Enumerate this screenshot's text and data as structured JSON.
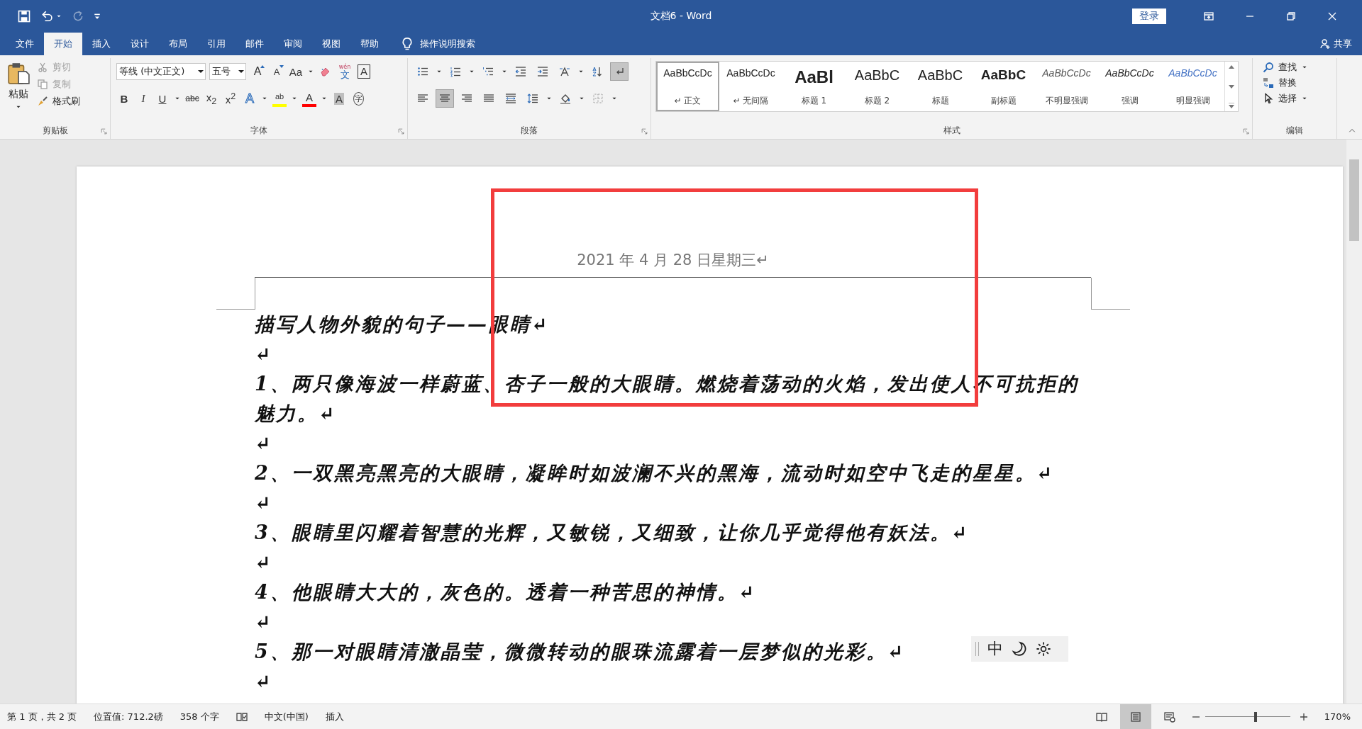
{
  "quick_access": [
    {
      "kind": "save",
      "disabled": false
    },
    {
      "kind": "undo",
      "disabled": false,
      "dropdown": true
    },
    {
      "kind": "redo",
      "disabled": true,
      "dropdown": false
    },
    {
      "kind": "customize",
      "disabled": false
    }
  ],
  "window": {
    "title": "文档6  -  Word",
    "sign_in": "登录"
  },
  "tabs": [
    {
      "label": "文件",
      "selected": false
    },
    {
      "label": "开始",
      "selected": true
    },
    {
      "label": "插入",
      "selected": false
    },
    {
      "label": "设计",
      "selected": false
    },
    {
      "label": "布局",
      "selected": false
    },
    {
      "label": "引用",
      "selected": false
    },
    {
      "label": "邮件",
      "selected": false
    },
    {
      "label": "审阅",
      "selected": false
    },
    {
      "label": "视图",
      "selected": false
    },
    {
      "label": "帮助",
      "selected": false
    }
  ],
  "tell_me": "操作说明搜索",
  "share": "共享",
  "clipboard": {
    "title": "剪贴板",
    "paste": "粘贴",
    "items": [
      {
        "kind": "cut",
        "label": "剪切",
        "disabled": true
      },
      {
        "kind": "copy",
        "label": "复制",
        "disabled": true
      },
      {
        "kind": "painter",
        "label": "格式刷",
        "disabled": false
      }
    ]
  },
  "font": {
    "title": "字体",
    "font_name": "等线 (中文正文)",
    "font_size": "五号",
    "row1": [
      {
        "kind": "grow",
        "label": "A",
        "dropdown": false
      },
      {
        "kind": "shrink",
        "label": "A",
        "dropdown": false
      },
      {
        "kind": "case",
        "label": "Aa",
        "dropdown": true
      },
      {
        "kind": "clear",
        "dropdown": false
      },
      {
        "kind": "phonetic",
        "label": "文",
        "ruby": "wén",
        "dropdown": false
      },
      {
        "kind": "border",
        "label": "A",
        "dropdown": false
      }
    ],
    "row2": [
      {
        "kind": "bold",
        "label": "B",
        "dropdown": false
      },
      {
        "kind": "italic",
        "label": "I",
        "dropdown": false
      },
      {
        "kind": "underline",
        "label": "U",
        "dropdown": true
      },
      {
        "kind": "strike",
        "label": "abc",
        "dropdown": false
      },
      {
        "kind": "sub",
        "label": "x$_{2}$",
        "dropdown": false
      },
      {
        "kind": "sup",
        "label": "x$^{2}$",
        "dropdown": false
      },
      {
        "kind": "effects",
        "label": "A",
        "dropdown": true
      },
      {
        "kind": "highlight",
        "label": "ab",
        "color": "#ffff00",
        "dropdown": true
      },
      {
        "kind": "font-color",
        "label": "A",
        "color": "#ff0000",
        "dropdown": true
      },
      {
        "kind": "shade",
        "label": "A",
        "dropdown": false
      },
      {
        "kind": "enclose",
        "label": "字",
        "dropdown": false
      }
    ]
  },
  "paragraph": {
    "title": "段落",
    "row1": [
      {
        "kind": "bullets",
        "selected": false,
        "dropdown": true
      },
      {
        "kind": "numbering",
        "selected": false,
        "dropdown": true
      },
      {
        "kind": "multilevel",
        "selected": false,
        "dropdown": true
      },
      {
        "kind": "outdent",
        "selected": false,
        "dropdown": false
      },
      {
        "kind": "indent",
        "selected": false,
        "dropdown": false
      },
      {
        "kind": "asian",
        "selected": false,
        "dropdown": true
      },
      {
        "kind": "sort",
        "selected": false,
        "dropdown": false
      },
      {
        "kind": "marks",
        "selected": true,
        "dropdown": false
      }
    ],
    "row2": [
      {
        "kind": "align-left",
        "selected": false,
        "dropdown": false
      },
      {
        "kind": "align-center",
        "selected": true,
        "dropdown": false
      },
      {
        "kind": "align-right",
        "selected": false,
        "dropdown": false
      },
      {
        "kind": "justify",
        "selected": false,
        "dropdown": false
      },
      {
        "kind": "distributed",
        "selected": false,
        "dropdown": false
      },
      {
        "kind": "line-spacing",
        "selected": false,
        "dropdown": true
      },
      {
        "kind": "shading",
        "selected": false,
        "dropdown": true
      },
      {
        "kind": "borders",
        "selected": false,
        "dropdown": true
      }
    ]
  },
  "styles": {
    "title": "样式",
    "items": [
      {
        "kind": "normal",
        "sample": "AaBbCcDc",
        "name": "↵ 正文",
        "selected": true
      },
      {
        "kind": "normal",
        "sample": "AaBbCcDc",
        "name": "↵ 无间隔",
        "selected": false
      },
      {
        "kind": "heading1",
        "sample": "AaBl",
        "name": "标题 1",
        "selected": false
      },
      {
        "kind": "heading2",
        "sample": "AaBbC",
        "name": "标题 2",
        "selected": false
      },
      {
        "kind": "title",
        "sample": "AaBbC",
        "name": "标题",
        "selected": false
      },
      {
        "kind": "subtitle",
        "sample": "AaBbC",
        "name": "副标题",
        "selected": false
      },
      {
        "kind": "subtle",
        "sample": "AaBbCcDc",
        "name": "不明显强调",
        "selected": false
      },
      {
        "kind": "emphasis",
        "sample": "AaBbCcDc",
        "name": "强调",
        "selected": false
      },
      {
        "kind": "intense",
        "sample": "AaBbCcDc",
        "name": "明显强调",
        "selected": false
      }
    ]
  },
  "editing": {
    "title": "编辑",
    "items": [
      {
        "kind": "find",
        "label": "查找",
        "dropdown": true
      },
      {
        "kind": "replace",
        "label": "替换",
        "dropdown": false
      },
      {
        "kind": "select",
        "label": "选择",
        "dropdown": true
      }
    ]
  },
  "document": {
    "header": "2021 年 4 月 28 日星期三↵",
    "paragraphs": [
      "描写人物外貌的句子——眼睛↵",
      "↵",
      "1、两只像海波一样蔚蓝、杏子一般的大眼睛。燃烧着荡动的火焰，发出使人不可抗拒的魅力。↵",
      "↵",
      "2、一双黑亮黑亮的大眼睛，凝眸时如波澜不兴的黑海，流动时如空中飞走的星星。↵",
      "↵",
      "3、眼睛里闪耀着智慧的光辉，又敏锐，又细致，让你几乎觉得他有妖法。↵",
      "↵",
      "4、他眼睛大大的，灰色的。透着一种苦思的神情。↵",
      "↵",
      "5、那一对眼睛清澈晶莹，微微转动的眼珠流露着一层梦似的光彩。↵",
      "↵"
    ]
  },
  "ime": {
    "label": "中"
  },
  "status_bar": {
    "items": [
      {
        "kind": "text",
        "label": "第 1 页，共 2 页"
      },
      {
        "kind": "text",
        "label": "位置值: 712.2磅"
      },
      {
        "kind": "text",
        "label": "358 个字"
      },
      {
        "kind": "proofing"
      },
      {
        "kind": "text",
        "label": "中文(中国)"
      },
      {
        "kind": "text",
        "label": "插入"
      }
    ],
    "views": [
      {
        "kind": "read",
        "selected": false
      },
      {
        "kind": "print",
        "selected": true
      },
      {
        "kind": "web",
        "selected": false
      }
    ],
    "zoom": {
      "level": 0.59,
      "label": "170%"
    }
  }
}
